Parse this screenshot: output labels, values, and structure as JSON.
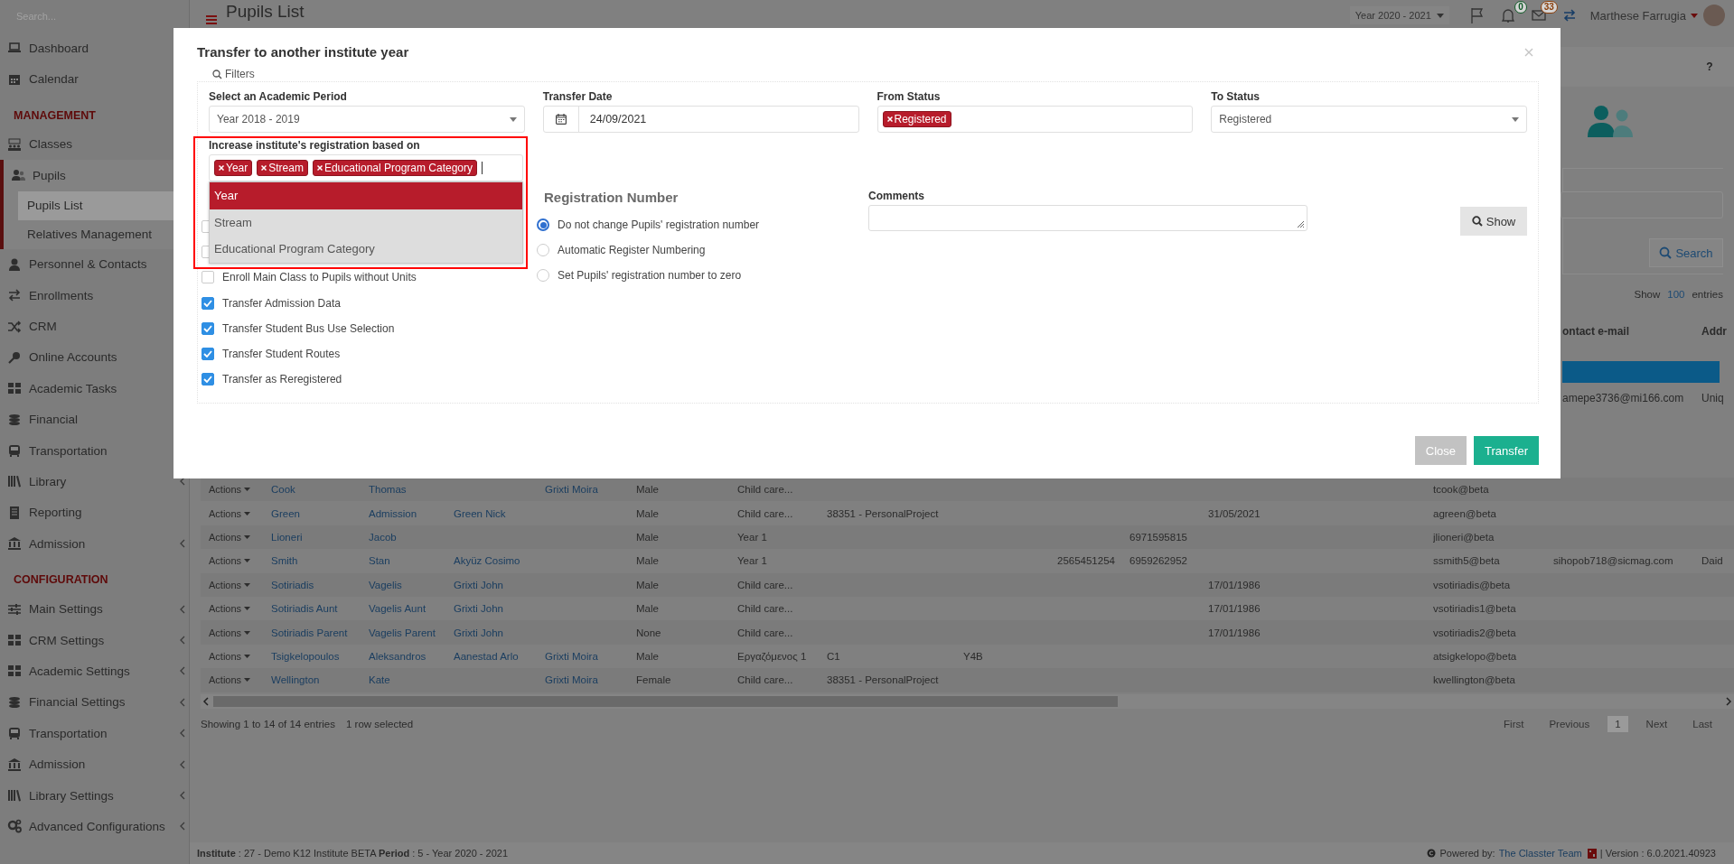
{
  "sidebar": {
    "search": {
      "placeholder": "Search..."
    },
    "items": [
      {
        "kind": "item",
        "label": "Dashboard",
        "selected": false
      },
      {
        "kind": "item",
        "label": "Calendar",
        "selected": false
      },
      {
        "kind": "heading",
        "label": "MANAGEMENT"
      },
      {
        "kind": "item",
        "label": "Classes",
        "selected": false
      },
      {
        "kind": "item",
        "label": "Pupils",
        "selected": false,
        "expanded": true,
        "children": [
          {
            "label": "Pupils List",
            "selected": true
          },
          {
            "label": "Relatives Management",
            "selected": false
          }
        ]
      },
      {
        "kind": "item",
        "label": "Personnel & Contacts",
        "selected": false
      },
      {
        "kind": "item",
        "label": "Enrollments",
        "selected": false
      },
      {
        "kind": "item",
        "label": "CRM",
        "selected": false
      },
      {
        "kind": "item",
        "label": "Online Accounts",
        "selected": false
      },
      {
        "kind": "item",
        "label": "Academic Tasks",
        "selected": false
      },
      {
        "kind": "item",
        "label": "Financial",
        "selected": false
      },
      {
        "kind": "item",
        "label": "Transportation",
        "selected": false
      },
      {
        "kind": "item",
        "label": "Library",
        "selected": false,
        "expanded": false
      },
      {
        "kind": "item",
        "label": "Reporting",
        "selected": false
      },
      {
        "kind": "item",
        "label": "Admission",
        "selected": false,
        "expanded": false
      },
      {
        "kind": "heading",
        "label": "CONFIGURATION"
      },
      {
        "kind": "item",
        "label": "Main Settings",
        "selected": false,
        "expanded": false
      },
      {
        "kind": "item",
        "label": "CRM Settings",
        "selected": false,
        "expanded": false
      },
      {
        "kind": "item",
        "label": "Academic Settings",
        "selected": false,
        "expanded": false
      },
      {
        "kind": "item",
        "label": "Financial Settings",
        "selected": false,
        "expanded": false
      },
      {
        "kind": "item",
        "label": "Transportation",
        "selected": false,
        "expanded": false
      },
      {
        "kind": "item",
        "label": "Admission",
        "selected": false,
        "expanded": false
      },
      {
        "kind": "item",
        "label": "Library Settings",
        "selected": false,
        "expanded": false
      },
      {
        "kind": "item",
        "label": "Advanced Configurations",
        "selected": false,
        "expanded": false
      }
    ]
  },
  "topbar": {
    "title": "Pupils List",
    "period": "Year 2020 - 2021",
    "badges": [
      {
        "count": "0",
        "color": "#0f5a26"
      },
      {
        "count": "33",
        "color": "#8a3e0a"
      }
    ],
    "user": "Marthese Farrugia"
  },
  "help": "?",
  "side_panel": {
    "search_button": "Search",
    "entries": {
      "prefix": "Show",
      "count": "100",
      "suffix": "entries"
    },
    "columns": [
      "ontact e-mail",
      "Addr"
    ],
    "rows": [
      {
        "selected": true
      },
      {
        "selected": false,
        "cells": [
          "amepe3736@mi166.com",
          "Uniq"
        ]
      }
    ]
  },
  "table": {
    "rows": [
      {
        "actions": "Actions",
        "cells": [
          "Cook",
          "Thomas",
          null,
          "Grixti Moira",
          "Male",
          "Child care...",
          null,
          null,
          null,
          null,
          null,
          "tcook@beta",
          null,
          null
        ]
      },
      {
        "actions": "Actions",
        "cells": [
          "Green",
          "Admission",
          "Green Nick",
          null,
          "Male",
          "Child care...",
          "38351 - PersonalProject",
          null,
          null,
          null,
          "31/05/2021",
          "agreen@beta",
          null,
          null
        ]
      },
      {
        "actions": "Actions",
        "cells": [
          "Lioneri",
          "Jacob",
          null,
          null,
          "Male",
          "Year 1",
          null,
          null,
          null,
          "6971595815",
          null,
          "jlioneri@beta",
          null,
          null
        ]
      },
      {
        "actions": "Actions",
        "cells": [
          "Smith",
          "Stan",
          "Akyüz Cosimo",
          null,
          "Male",
          "Year 1",
          null,
          null,
          "2565451254",
          "6959262952",
          null,
          "ssmith5@beta",
          "sihopob718@sicmag.com",
          "Daid"
        ]
      },
      {
        "actions": "Actions",
        "cells": [
          "Sotiriadis",
          "Vagelis",
          "Grixti John",
          null,
          "Male",
          "Child care...",
          null,
          null,
          null,
          null,
          "17/01/1986",
          "vsotiriadis@beta",
          null,
          null
        ]
      },
      {
        "actions": "Actions",
        "cells": [
          "Sotiriadis Aunt",
          "Vagelis Aunt",
          "Grixti John",
          null,
          "Male",
          "Child care...",
          null,
          null,
          null,
          null,
          "17/01/1986",
          "vsotiriadis1@beta",
          null,
          null
        ]
      },
      {
        "actions": "Actions",
        "cells": [
          "Sotiriadis Parent",
          "Vagelis Parent",
          "Grixti John",
          null,
          "None",
          "Child care...",
          null,
          null,
          null,
          null,
          "17/01/1986",
          "vsotiriadis2@beta",
          null,
          null
        ]
      },
      {
        "actions": "Actions",
        "cells": [
          "Tsigkelopoulos",
          "Aleksandros",
          "Aanestad Arlo",
          "Grixti Moira",
          "Male",
          "Εργαζόμενος 1",
          "C1",
          "Y4B",
          null,
          null,
          null,
          "atsigkelopo@beta",
          null,
          null
        ]
      },
      {
        "actions": "Actions",
        "cells": [
          "Wellington",
          "Kate",
          null,
          "Grixti Moira",
          "Female",
          "Child care...",
          "38351 - PersonalProject",
          null,
          null,
          null,
          null,
          "kwellington@beta",
          null,
          null
        ]
      }
    ],
    "info": "Showing 1 to 14 of 14 entries",
    "selection_info": "1 row selected",
    "pagination": [
      {
        "label": "First",
        "selected": false
      },
      {
        "label": "Previous",
        "selected": false
      },
      {
        "label": "1",
        "selected": true
      },
      {
        "label": "Next",
        "selected": false
      },
      {
        "label": "Last",
        "selected": false
      }
    ]
  },
  "footer": {
    "institute": "**Institute** : 27 - Demo K12 Institute BETA **Period** : 5 - Year 2020 - 2021",
    "powered": "Powered by:",
    "link": "The Classter Team",
    "version": "| Version : 6.0.2021.40923"
  },
  "modal": {
    "title": "Transfer to another institute year",
    "legend": "Filters",
    "fields": [
      {
        "kind": "select",
        "label": "Select an Academic Period",
        "value": "Year 2018 - 2019"
      },
      {
        "kind": "date",
        "label": "Transfer Date",
        "value": "24/09/2021"
      },
      {
        "kind": "tags",
        "label": "From Status",
        "tags": [
          "Registered"
        ]
      },
      {
        "kind": "select",
        "label": "To Status",
        "value": "Registered"
      }
    ],
    "basis": {
      "label": "Increase institute's registration based on",
      "tags": [
        "Year",
        "Stream",
        "Educational Program Category"
      ],
      "open": true,
      "options": [
        {
          "label": "Year",
          "selected": true
        },
        {
          "label": "Stream",
          "selected": false
        },
        {
          "label": "Educational Program Category",
          "selected": false
        }
      ]
    },
    "checkboxes": [
      {
        "checked": false
      },
      {
        "checked": false
      },
      {
        "label": "Enroll Main Class to Pupils without Units",
        "checked": false
      },
      {
        "label": "Transfer Admission Data",
        "checked": true
      },
      {
        "label": "Transfer Student Bus Use Selection",
        "checked": true
      },
      {
        "label": "Transfer Student Routes",
        "checked": true
      },
      {
        "label": "Transfer as Reregistered",
        "checked": true
      }
    ],
    "registration": {
      "title": "Registration Number",
      "options": [
        {
          "label": "Do not change Pupils' registration number",
          "selected": true
        },
        {
          "label": "Automatic Register Numbering",
          "selected": false
        },
        {
          "label": "Set Pupils' registration number to zero",
          "selected": false
        }
      ]
    },
    "comments": {
      "label": "Comments"
    },
    "show_button": "Show",
    "buttons": [
      {
        "kind": "secondary",
        "label": "Close"
      },
      {
        "kind": "primary",
        "label": "Transfer"
      }
    ]
  }
}
